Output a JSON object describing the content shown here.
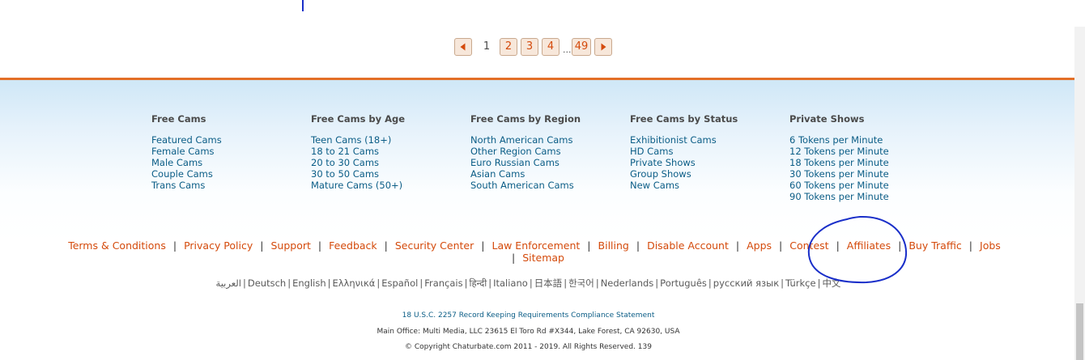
{
  "pagination": {
    "prev_icon": "arrow-left",
    "next_icon": "arrow-right",
    "current": "1",
    "pages": [
      "2",
      "3",
      "4"
    ],
    "ellipsis": "...",
    "last": "49"
  },
  "footer": {
    "columns": [
      {
        "heading": "Free Cams",
        "links": [
          "Featured Cams",
          "Female Cams",
          "Male Cams",
          "Couple Cams",
          "Trans Cams"
        ]
      },
      {
        "heading": "Free Cams by Age",
        "links": [
          "Teen Cams (18+)",
          "18 to 21 Cams",
          "20 to 30 Cams",
          "30 to 50 Cams",
          "Mature Cams (50+)"
        ]
      },
      {
        "heading": "Free Cams by Region",
        "links": [
          "North American Cams",
          "Other Region Cams",
          "Euro Russian Cams",
          "Asian Cams",
          "South American Cams"
        ]
      },
      {
        "heading": "Free Cams by Status",
        "links": [
          "Exhibitionist Cams",
          "HD Cams",
          "Private Shows",
          "Group Shows",
          "New Cams"
        ]
      },
      {
        "heading": "Private Shows",
        "links": [
          "6 Tokens per Minute",
          "12 Tokens per Minute",
          "18 Tokens per Minute",
          "30 Tokens per Minute",
          "60 Tokens per Minute",
          "90 Tokens per Minute"
        ]
      }
    ],
    "bottom_links": [
      "Terms & Conditions",
      "Privacy Policy",
      "Support",
      "Feedback",
      "Security Center",
      "Law Enforcement",
      "Billing",
      "Disable Account",
      "Apps",
      "Contest",
      "Affiliates",
      "Buy Traffic",
      "Jobs",
      "Sitemap"
    ],
    "link_separator": "|",
    "languages": [
      "العربية",
      "Deutsch",
      "English",
      "Ελληνικά",
      "Español",
      "Français",
      "हिन्दी",
      "Italiano",
      "日本語",
      "한국어",
      "Nederlands",
      "Português",
      "русский язык",
      "Türkçe",
      "中文"
    ],
    "compliance": "18 U.S.C. 2257 Record Keeping Requirements Compliance Statement",
    "office": "Main Office: Multi Media, LLC 23615 El Toro Rd #X344, Lake Forest, CA 92630, USA",
    "copyright": "© Copyright Chaturbate.com 2011 - 2019. All Rights Reserved. 139"
  },
  "annotation": {
    "color": "#1a2fc9",
    "shape": "hand-drawn circle around Affiliates"
  }
}
